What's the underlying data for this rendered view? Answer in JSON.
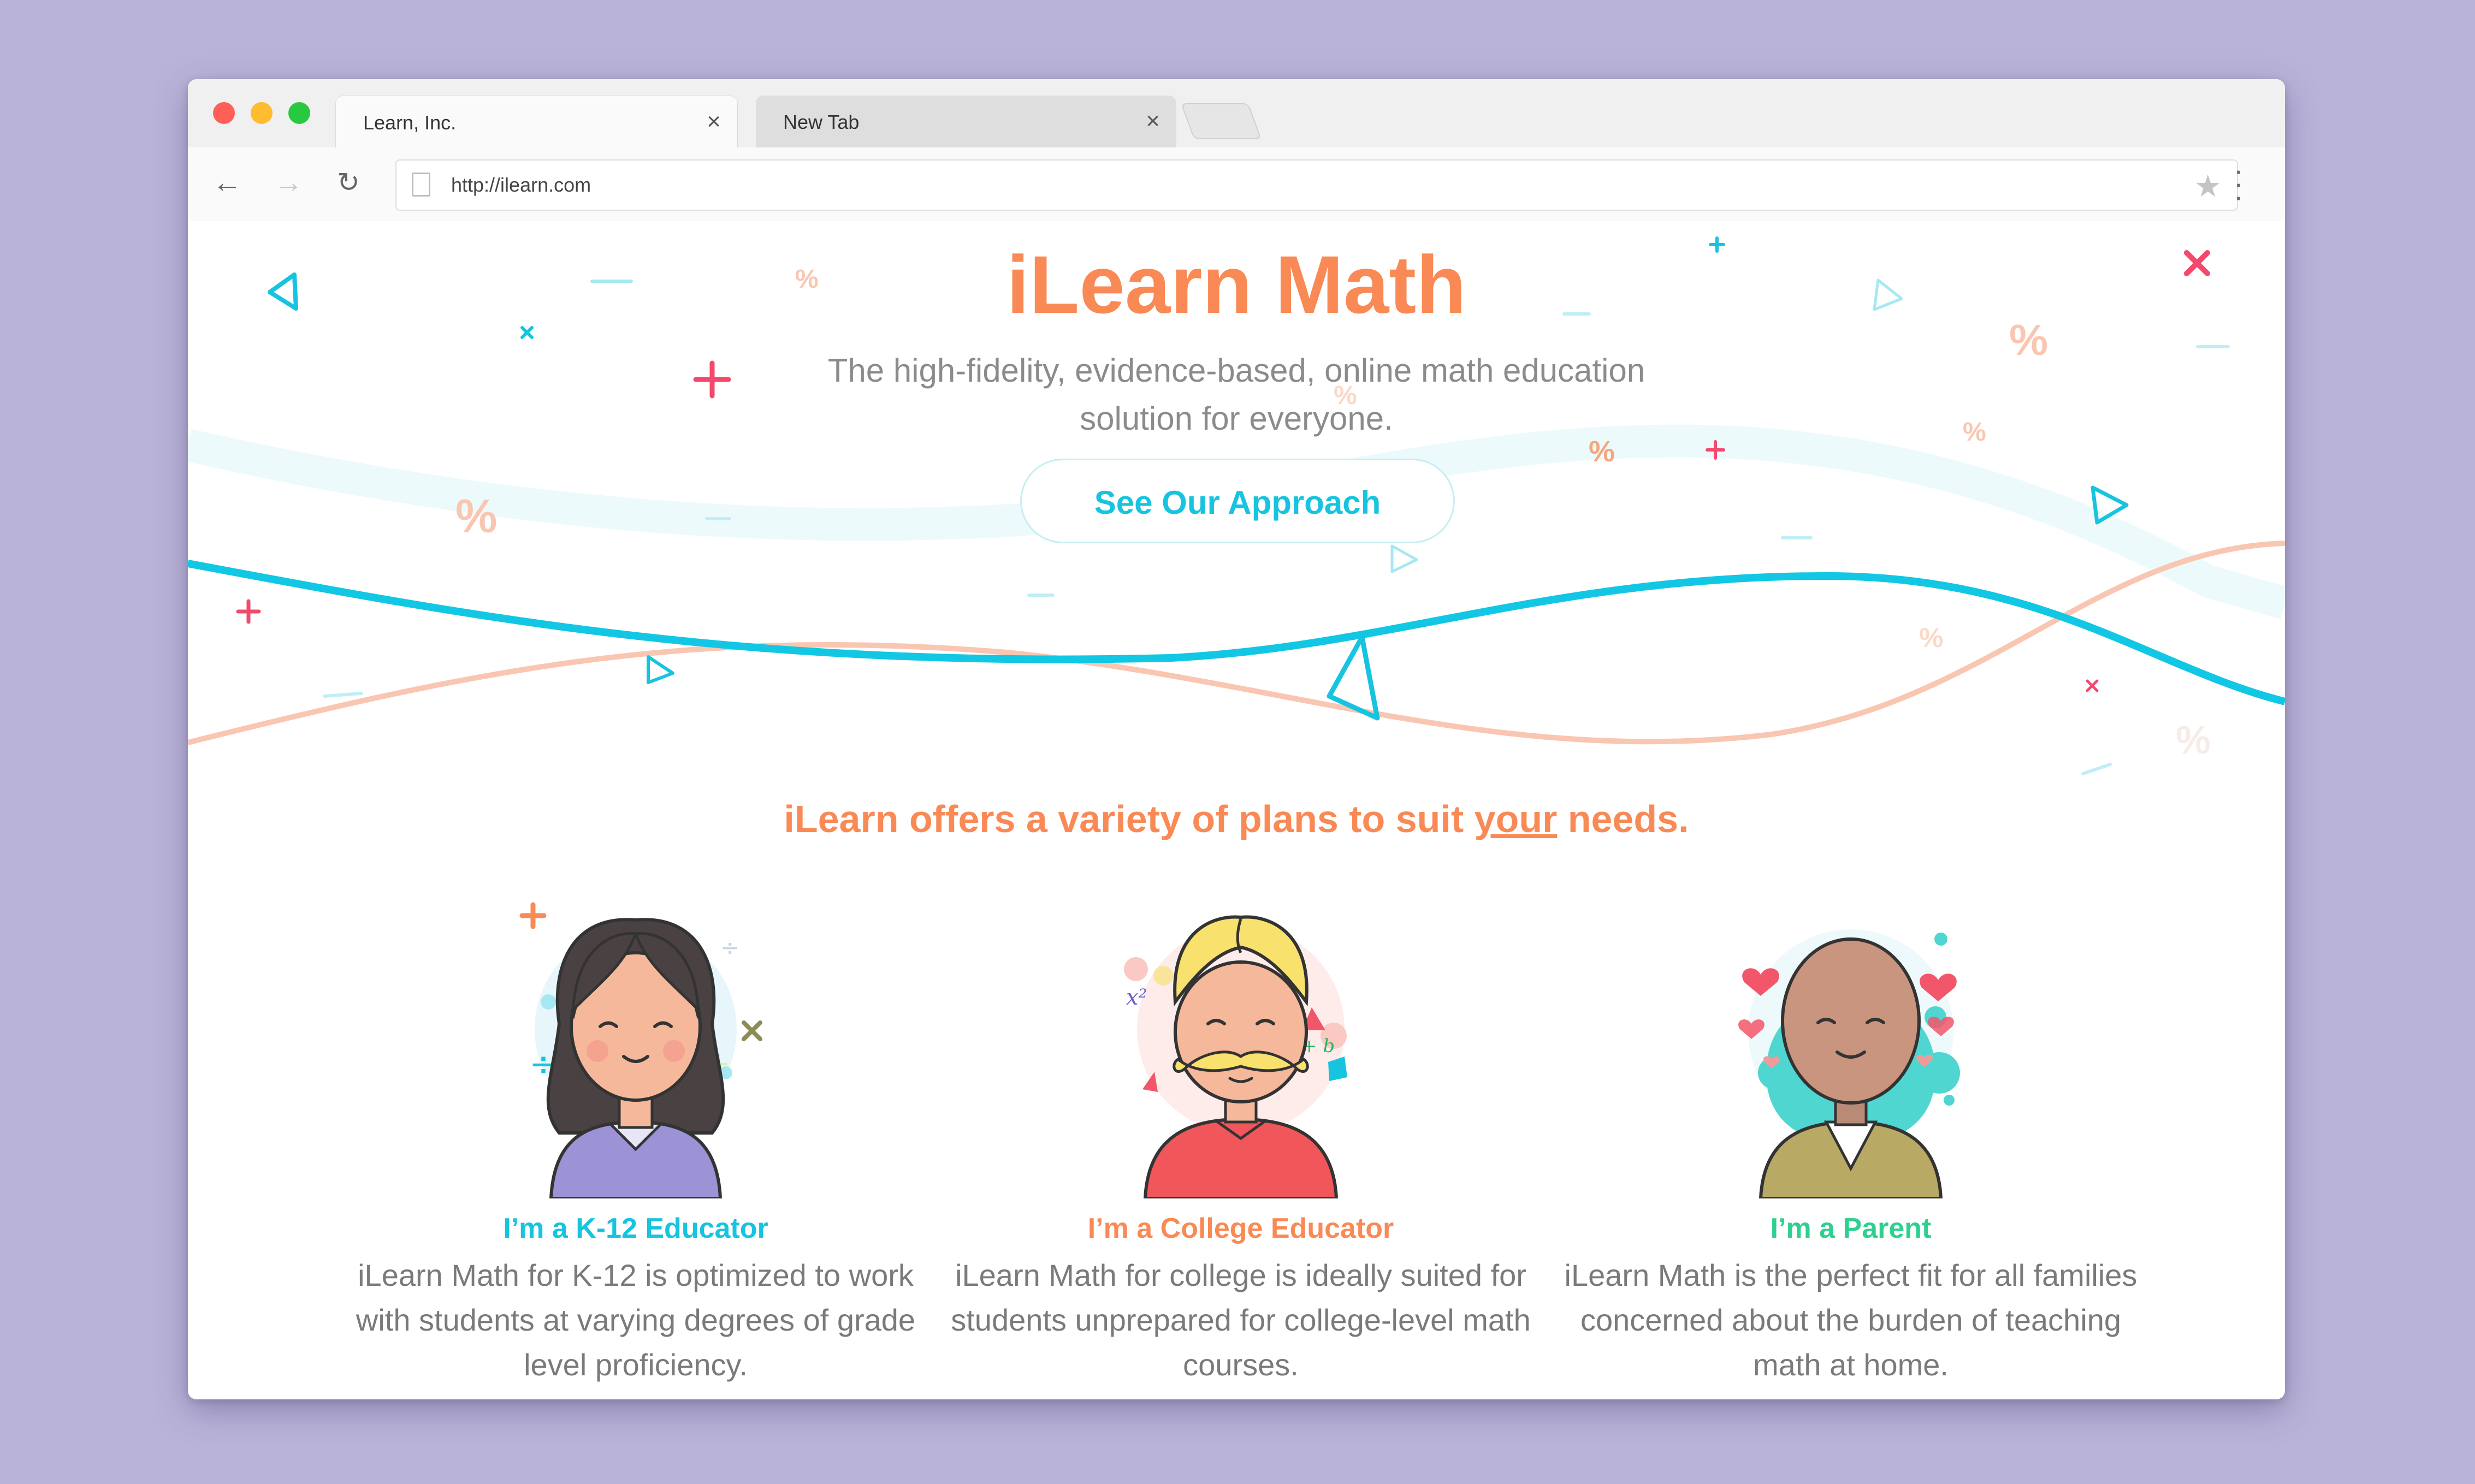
{
  "browser": {
    "tabs": [
      {
        "label": "Learn, Inc.",
        "active": true
      },
      {
        "label": "New Tab",
        "active": false
      }
    ],
    "url": "http://ilearn.com"
  },
  "hero": {
    "title": "iLearn Math",
    "subtitle": "The high-fidelity, evidence-based, online math education solution for everyone.",
    "cta_label": "See Our Approach"
  },
  "plans": {
    "heading_pre": "iLearn offers a variety of plans to suit ",
    "heading_em": "your",
    "heading_post": " needs.",
    "cards": [
      {
        "title": "I’m a K-12 Educator",
        "body": "iLearn Math for K-12 is optimized to work with students at varying degrees of grade level proficiency.",
        "title_color": "#16c4df"
      },
      {
        "title": "I’m a College Educator",
        "body": "iLearn Math for college is ideally suited for students unprepared for college-level math courses.",
        "title_color": "#f98a55"
      },
      {
        "title": "I’m a Parent",
        "body": "iLearn Math is the perfect fit for all families concerned about the burden of teaching math at home.",
        "title_color": "#2fd08f"
      }
    ]
  },
  "colors": {
    "accent_orange": "#f98a55",
    "accent_cyan": "#16c4df",
    "accent_green": "#2fd08f",
    "accent_pink": "#f2496c",
    "background": "#b9b3d8"
  }
}
